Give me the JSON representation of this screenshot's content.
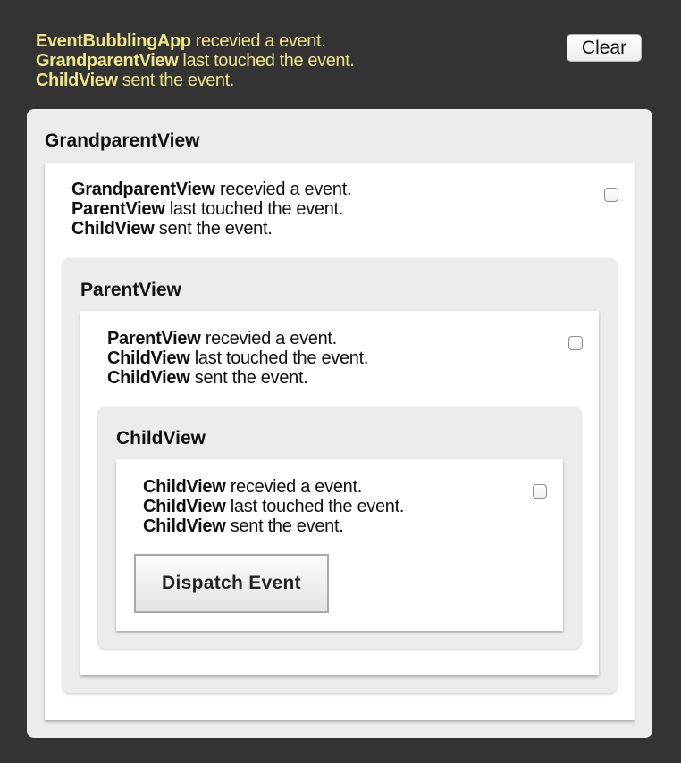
{
  "app_log": {
    "line1_name": "EventBubblingApp",
    "line1_text": " recevied a event.",
    "line2_name": "GrandparentView",
    "line2_text": " last touched the event.",
    "line3_name": "ChildView",
    "line3_text": " sent the event."
  },
  "clear_label": "Clear",
  "grandparent": {
    "title": "GrandparentView",
    "line1_name": "GrandparentView",
    "line1_text": " recevied a event.",
    "line2_name": "ParentView",
    "line2_text": " last touched the event.",
    "line3_name": "ChildView",
    "line3_text": " sent the event.",
    "checked": false
  },
  "parent": {
    "title": "ParentView",
    "line1_name": "ParentView",
    "line1_text": " recevied a event.",
    "line2_name": "ChildView",
    "line2_text": " last touched the event.",
    "line3_name": "ChildView",
    "line3_text": " sent the event.",
    "checked": false
  },
  "child": {
    "title": "ChildView",
    "line1_name": "ChildView",
    "line1_text": " recevied a event.",
    "line2_name": "ChildView",
    "line2_text": " last touched the event.",
    "line3_name": "ChildView",
    "line3_text": " sent the event.",
    "checked": false,
    "dispatch_label": "Dispatch Event"
  }
}
